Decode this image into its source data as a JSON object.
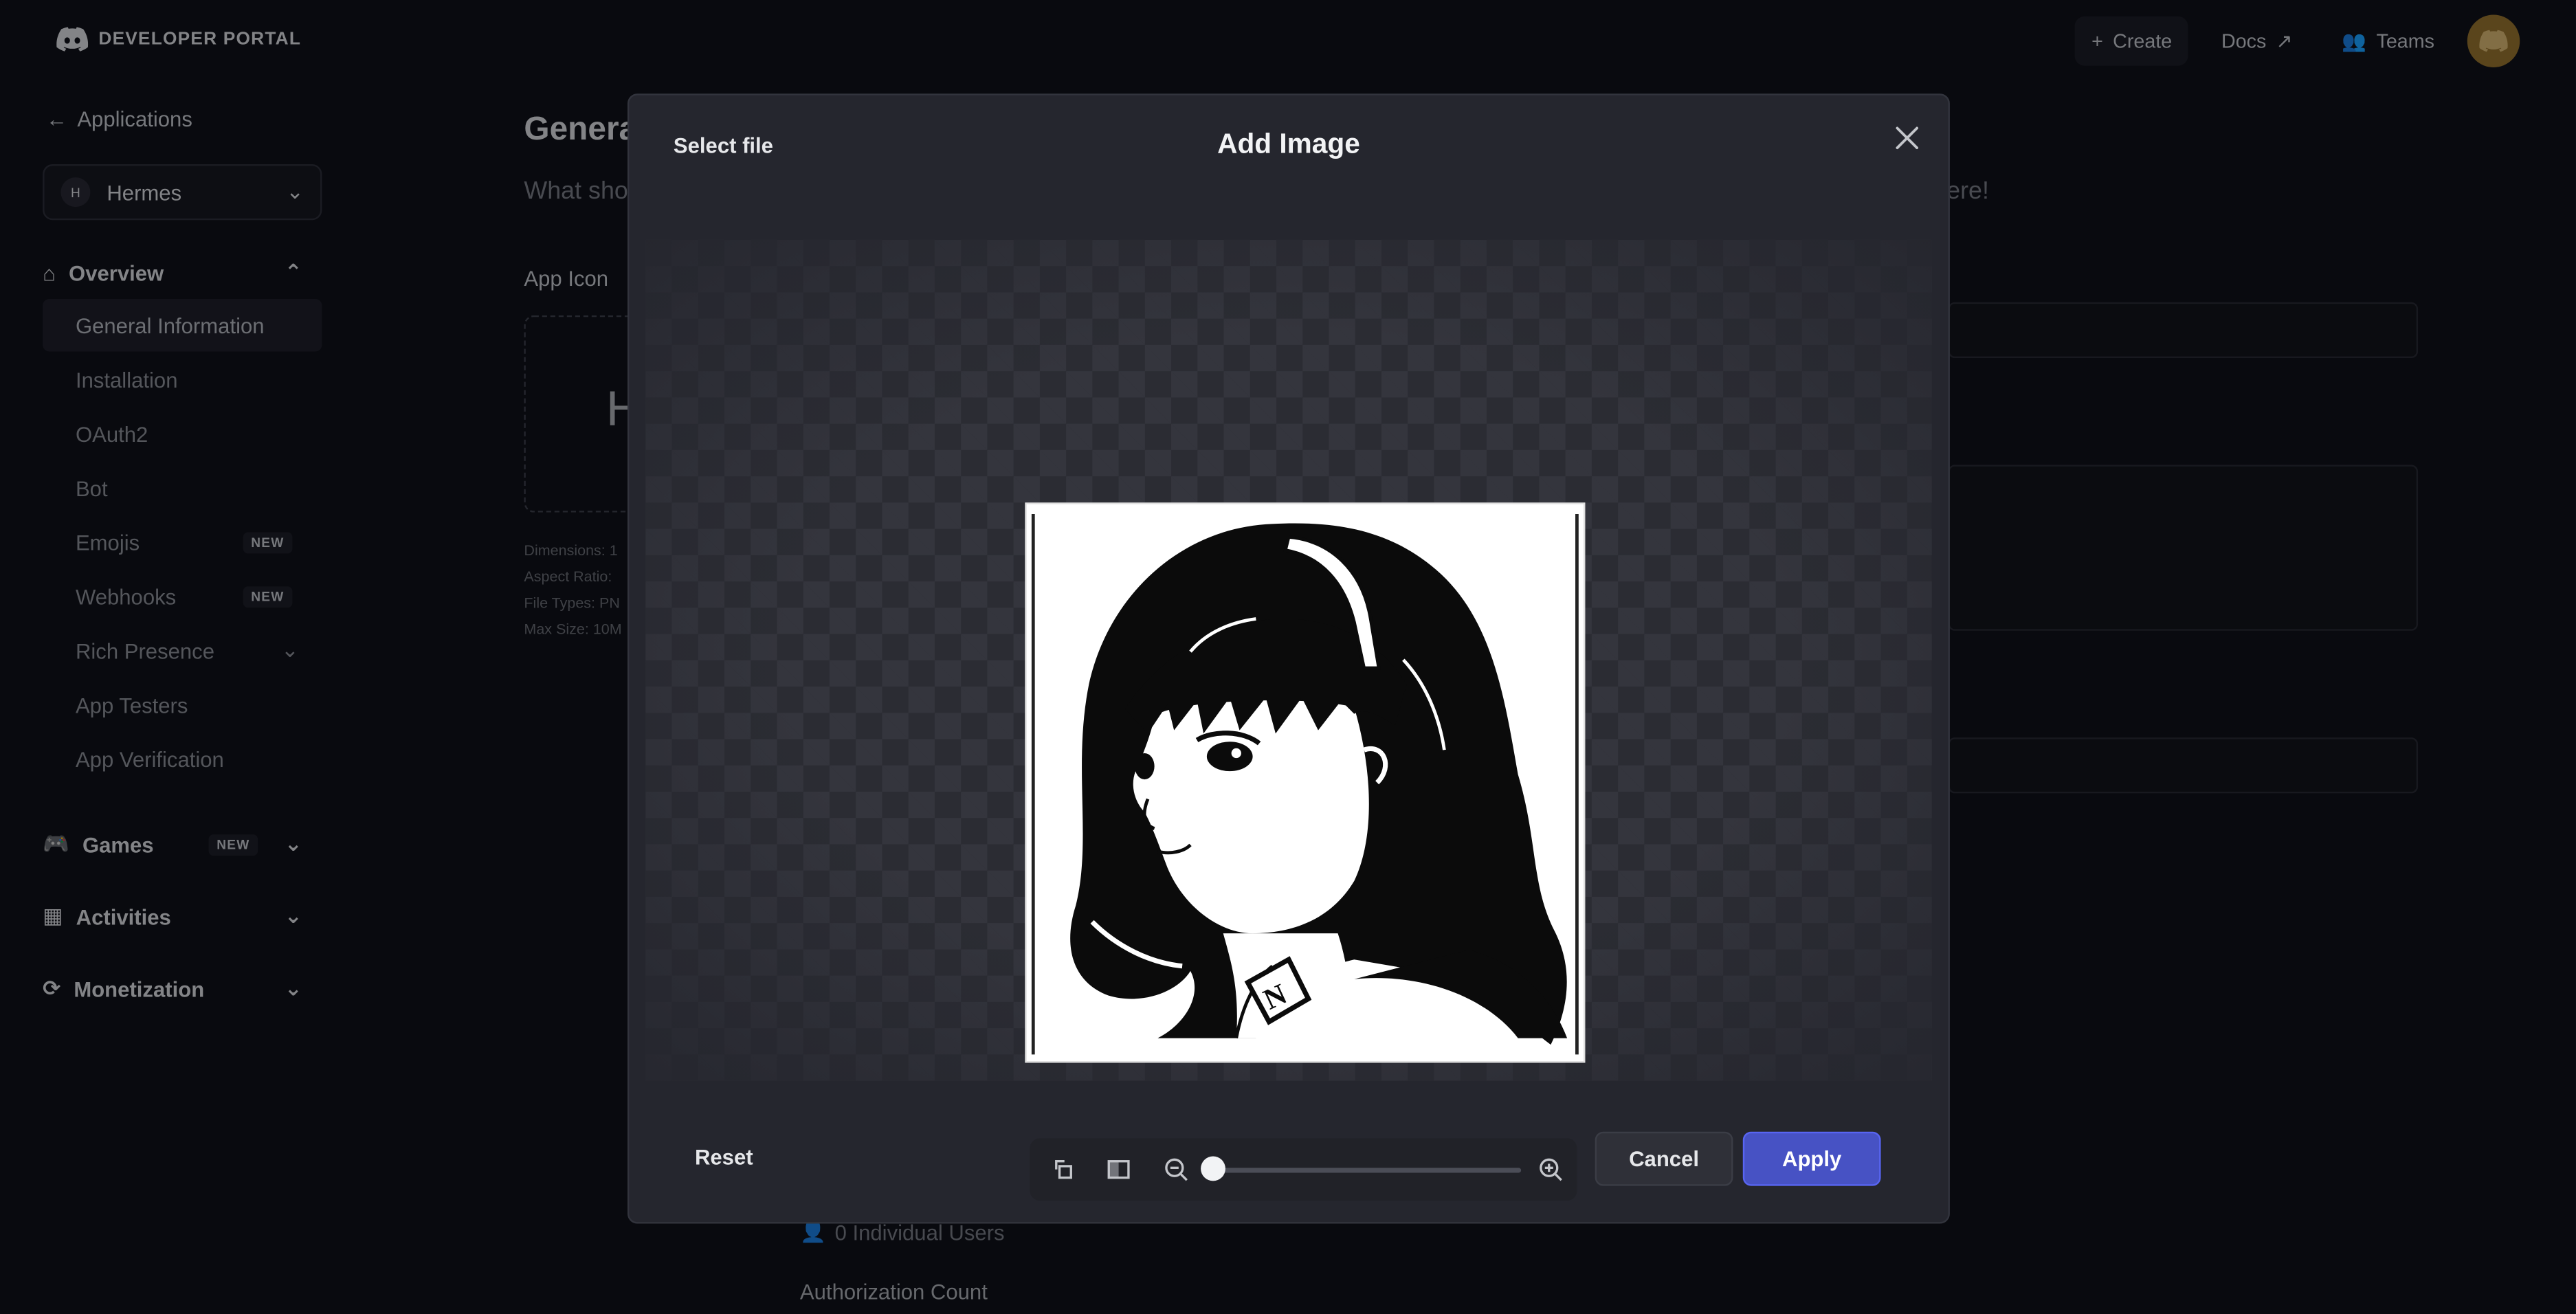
{
  "header": {
    "logo_text": "DEVELOPER PORTAL",
    "create_label": "Create",
    "docs_label": "Docs",
    "teams_label": "Teams"
  },
  "sidebar": {
    "back_label": "Applications",
    "app_letter": "H",
    "app_name": "Hermes",
    "overview_label": "Overview",
    "items": [
      {
        "label": "General Information",
        "badge": ""
      },
      {
        "label": "Installation",
        "badge": ""
      },
      {
        "label": "OAuth2",
        "badge": ""
      },
      {
        "label": "Bot",
        "badge": ""
      },
      {
        "label": "Emojis",
        "badge": "NEW"
      },
      {
        "label": "Webhooks",
        "badge": "NEW"
      },
      {
        "label": "Rich Presence",
        "badge": ""
      },
      {
        "label": "App Testers",
        "badge": ""
      },
      {
        "label": "App Verification",
        "badge": ""
      }
    ],
    "games_label": "Games",
    "games_badge": "NEW",
    "activities_label": "Activities",
    "monetization_label": "Monetization"
  },
  "main": {
    "title_fragment": "Genera",
    "subtitle_fragment": "What sho",
    "subtitle_end": "ere!",
    "app_icon_label": "App Icon",
    "icon_letter": "H",
    "meta": [
      "Dimensions: 1",
      "Aspect Ratio:",
      "File Types: PN",
      "Max Size: 10M"
    ],
    "users_text": "0 Individual Users",
    "auth_count_label": "Authorization Count"
  },
  "modal": {
    "select_file_label": "Select file",
    "title": "Add Image",
    "reset_label": "Reset",
    "cancel_label": "Cancel",
    "apply_label": "Apply",
    "zoom_level": 0,
    "badge_letter": "N"
  },
  "colors": {
    "accent": "#5865f2",
    "apply_bg": "#4752c4",
    "modal_bg": "#25262e",
    "page_bg": "#0f1017"
  }
}
